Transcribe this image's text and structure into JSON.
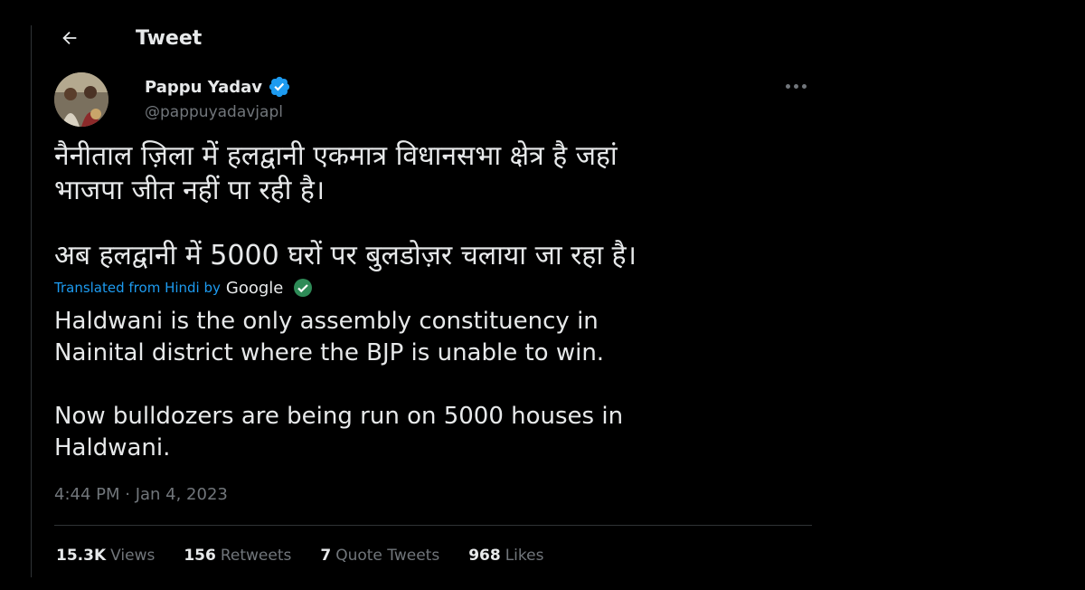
{
  "header": {
    "title": "Tweet",
    "back_icon": "arrow-left-icon"
  },
  "author": {
    "name": "Pappu Yadav",
    "handle": "@pappuyadavjapl",
    "verified_color": "#1d9bf0"
  },
  "tweet": {
    "hindi_lines": [
      "नैनीताल ज़िला में हलद्वानी एकमात्र विधानसभा क्षेत्र है जहां",
      "भाजपा जीत नहीं पा रही है।",
      "अब हलद्वानी में 5000 घरों पर बुलडोज़र चलाया जा रहा है।"
    ],
    "translation": {
      "label": "Translated from Hindi by",
      "provider": "Google"
    },
    "english_lines": [
      "Haldwani is the only assembly constituency in",
      "Nainital district where the BJP is unable to win.",
      "Now bulldozers are being run on 5000 houses in",
      "Haldwani."
    ],
    "timestamp": "4:44 PM · Jan 4, 2023"
  },
  "stats": {
    "views": {
      "num": "15.3K",
      "label": "Views"
    },
    "retweets": {
      "num": "156",
      "label": "Retweets"
    },
    "quotes": {
      "num": "7",
      "label": "Quote Tweets"
    },
    "likes": {
      "num": "968",
      "label": "Likes"
    }
  },
  "colors": {
    "background": "#000000",
    "text": "#e7e9ea",
    "muted": "#71767b",
    "accent": "#1d9bf0",
    "divider": "#2f3336"
  }
}
